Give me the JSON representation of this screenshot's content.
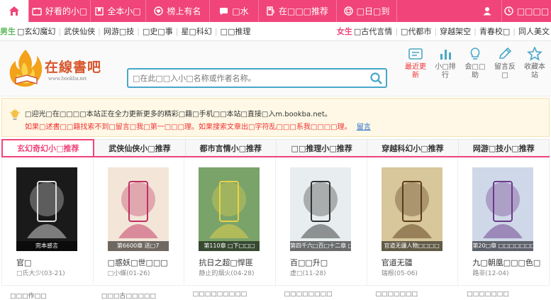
{
  "topnav": {
    "home_icon": "home-icon",
    "items": [
      {
        "label": "好看的小□",
        "icon": "book-open-icon"
      },
      {
        "label": "全本小□",
        "icon": "bookmark-icon"
      },
      {
        "label": "榜上有名",
        "icon": "heart-icon"
      },
      {
        "label": "□水",
        "icon": "chat-bubble-icon"
      },
      {
        "label": "在□□□推荐",
        "icon": "fuel-pump-icon"
      },
      {
        "label": "□日□到",
        "icon": "calendar-check-icon"
      },
      {
        "label": "",
        "icon": "user-icon"
      },
      {
        "label": "□□□□",
        "icon": "clock-icon"
      }
    ]
  },
  "categories": {
    "male_label": "男生",
    "male_items": [
      "□玄幻魔幻",
      "武侠仙侠",
      "网游□技",
      "□史□事",
      "星□科幻",
      "□□推理"
    ],
    "female_label": "女生",
    "female_items": [
      "□古代言情",
      "□代都市",
      "穿越架空",
      "青春校□",
      "同人美文"
    ]
  },
  "logo": {
    "text": "在線書吧",
    "subtext": "www.bookba.net"
  },
  "search": {
    "placeholder": "□在此□□入小□名称或作者名称。"
  },
  "tools": [
    {
      "label": "最近更新",
      "icon": "history-icon",
      "color": "#e33"
    },
    {
      "label": "小□排行",
      "icon": "bar-chart-icon",
      "color": "#48a7c8"
    },
    {
      "label": "会□□助",
      "icon": "lightbulb-icon",
      "color": "#48a7c8"
    },
    {
      "label": "留言反□",
      "icon": "pencil-icon",
      "color": "#48a7c8"
    },
    {
      "label": "收藏本站",
      "icon": "star-icon",
      "color": "#48a7c8"
    }
  ],
  "notice": {
    "line1": "□迎光□在□□□□本站正在全力更新更多的精彩□籍□手机□□本站□直接□入m.bookba.net。",
    "line2": "如果□述書□□籍找索不到□留言□我□第一□□□理。如果搜索文章出□字符乱□□□系我□□□□理。",
    "link": "留言"
  },
  "tabs": [
    "玄幻奇幻小□推荐",
    "武侠仙侠小□推荐",
    "都市言情小□推荐",
    "□□推理小□推荐",
    "穿越科幻小□推荐",
    "网游□技小□推荐"
  ],
  "books": [
    {
      "title": "官□",
      "author": "□氏大少(03-21)",
      "band": "完本感言",
      "cover_bg": "#1a1a1a",
      "cover_fg": "#ddd"
    },
    {
      "title": "□惑妖□世□□□",
      "author": "□小蝶(01-26)",
      "band": "第6600章 送□7",
      "cover_bg": "#f3e6d8",
      "cover_fg": "#c03060"
    },
    {
      "title": "抗日之超□悍匪",
      "author": "静止的烟火(04-28)",
      "band": "第110章 □下□□□",
      "cover_bg": "#7aa36a",
      "cover_fg": "#e8d34a"
    },
    {
      "title": "百□□升□",
      "author": "虚□(11-28)",
      "band": "第四千六□百□十二章 □",
      "cover_bg": "#e8eef0",
      "cover_fg": "#333"
    },
    {
      "title": "官道无疆",
      "author": "瑞根(05-06)",
      "band": "官道无疆人物□□□□",
      "cover_bg": "#d7c79b",
      "cover_fg": "#5a3a1a"
    },
    {
      "title": "九□朝凰□□□色□",
      "author": "路非(12-04)",
      "band": "第20□章 □□□□□□□",
      "cover_bg": "#cfd8e8",
      "cover_fg": "#6a3a8a"
    }
  ],
  "bottom_items": [
    "□□□作□□",
    "□□□古□□□□□",
    "□□□□□□□□□",
    "□□□□□□□□",
    "□□□□□□□",
    "□□□□□□□"
  ]
}
